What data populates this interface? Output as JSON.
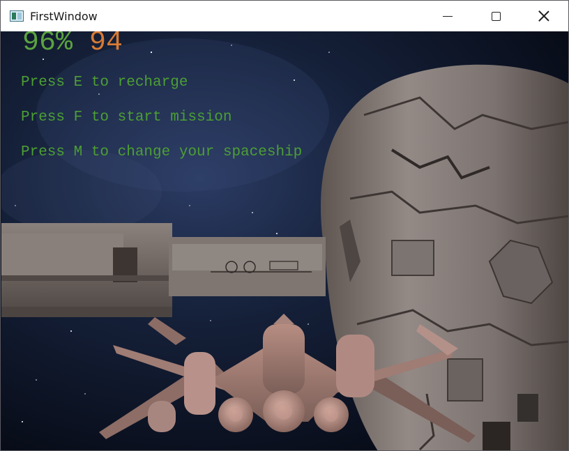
{
  "window": {
    "title": "FirstWindow",
    "icon": "app-window-icon"
  },
  "titlebar_buttons": {
    "minimize": "minimize-icon",
    "maximize": "maximize-icon",
    "close": "close-icon"
  },
  "hud": {
    "health": "96%",
    "ammo": "94",
    "instructions": [
      "Press E to recharge",
      "Press F to start mission",
      "Press M to change your spaceship"
    ]
  },
  "colors": {
    "health": "#5ba33f",
    "ammo": "#d77b35",
    "instructions": "#4c9f34",
    "space": "#0c1120"
  }
}
